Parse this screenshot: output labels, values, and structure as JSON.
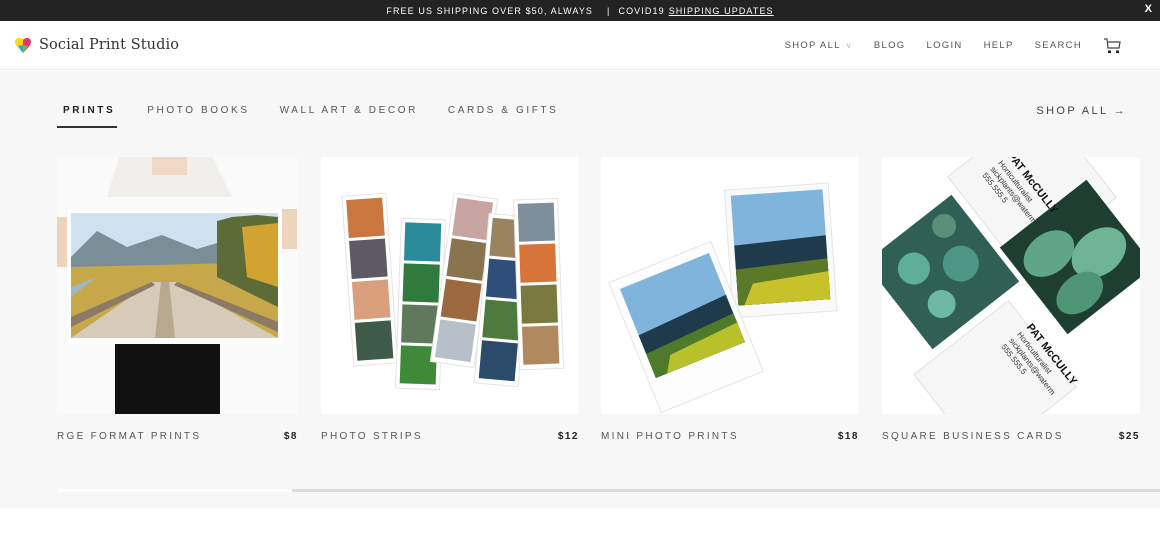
{
  "promo": {
    "text": "FREE US SHIPPING OVER $50, ALWAYS",
    "separator": "|",
    "prefix": "COVID19",
    "link": "SHIPPING UPDATES",
    "close": "X"
  },
  "header": {
    "brand": "Social Print Studio",
    "nav": [
      {
        "label": "SHOP ALL",
        "has_dropdown": true
      },
      {
        "label": "BLOG"
      },
      {
        "label": "LOGIN"
      },
      {
        "label": "HELP"
      },
      {
        "label": "SEARCH"
      }
    ],
    "chevron": "∨",
    "cart_icon": "cart-icon"
  },
  "tabs": [
    {
      "label": "PRINTS",
      "active": true
    },
    {
      "label": "PHOTO BOOKS"
    },
    {
      "label": "WALL ART & DECOR"
    },
    {
      "label": "CARDS & GIFTS"
    }
  ],
  "shop_all": "SHOP ALL →",
  "products": [
    {
      "name": "RGE FORMAT PRINTS",
      "price": "$8",
      "image": "person holding large landscape print of wooden bridge and autumn trees"
    },
    {
      "name": "PHOTO STRIPS",
      "price": "$12",
      "image": "collection of photo strips"
    },
    {
      "name": "MINI PHOTO PRINTS",
      "price": "$18",
      "image": "two mini prints of coastal landscape"
    },
    {
      "name": "SQUARE BUSINESS CARDS",
      "price": "$25",
      "image": "square business cards with plant photos"
    }
  ],
  "business_card": {
    "name": "PAT McCULLY",
    "title": "Horticulturalist",
    "email": "sickplants@waterm",
    "phone": "555.555.5"
  },
  "scroll": {
    "position": 0.21
  },
  "colors": {
    "promo_bg": "#232323",
    "main_bg": "#f7f7f7",
    "accent": "#333333"
  }
}
